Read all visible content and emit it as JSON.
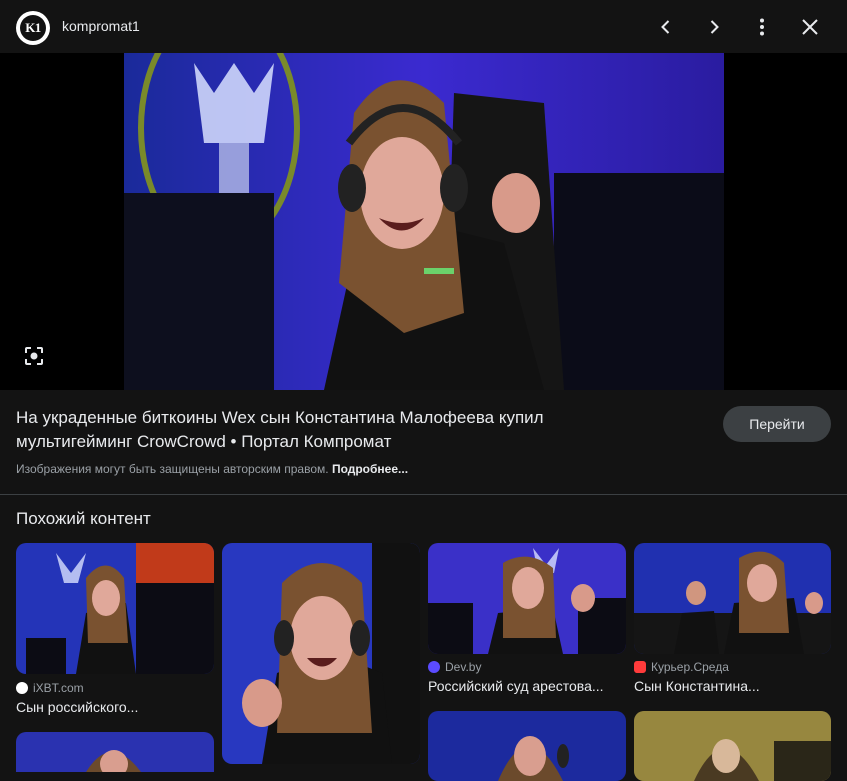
{
  "header": {
    "logo_text": "K1",
    "site_name": "kompromat1",
    "icons": [
      "chevron-left-icon",
      "chevron-right-icon",
      "more-vert-icon",
      "close-icon"
    ]
  },
  "main": {
    "title": "На украденные биткоины Wex сын Константина Малофеева купил мультигейминг CrowCrowd • Портал Компромат",
    "copyright": "Изображения могут быть защищены авторским правом.",
    "more_link": "Подробнее...",
    "visit_label": "Перейти"
  },
  "related": {
    "title": "Похожий контент",
    "cards": [
      {
        "source": "iXBT.com",
        "caption": "Сын российского..."
      },
      {
        "source": "",
        "caption": ""
      },
      {
        "source": "Dev.by",
        "caption": "Российский суд арестова..."
      },
      {
        "source": "Курьер.Среда",
        "caption": "Сын Константина..."
      }
    ]
  },
  "colors": {
    "background": "#131313",
    "button": "#3c4043",
    "text": "#e8eaed",
    "muted": "#9aa0a6"
  }
}
